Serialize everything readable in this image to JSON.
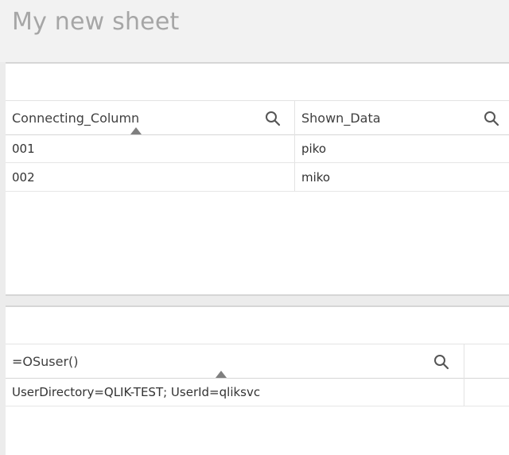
{
  "sheet": {
    "title": "My new sheet"
  },
  "table1": {
    "columns": [
      {
        "label": "Connecting_Column",
        "search_icon": "search-icon",
        "sorted": true
      },
      {
        "label": "Shown_Data",
        "search_icon": "search-icon",
        "sorted": false
      }
    ],
    "rows": [
      [
        "001",
        "piko"
      ],
      [
        "002",
        "miko"
      ]
    ]
  },
  "table2": {
    "columns": [
      {
        "label": "=OSuser()",
        "search_icon": "search-icon",
        "sorted": true
      },
      {
        "label": "",
        "search_icon": "",
        "sorted": false
      }
    ],
    "rows": [
      [
        "UserDirectory=QLIK-TEST; UserId=qliksvc",
        ""
      ]
    ]
  },
  "colors": {
    "title": "#a6a6a6",
    "background": "#ececec",
    "panel": "#ffffff",
    "sort_indicator": "#7f7f7f"
  }
}
